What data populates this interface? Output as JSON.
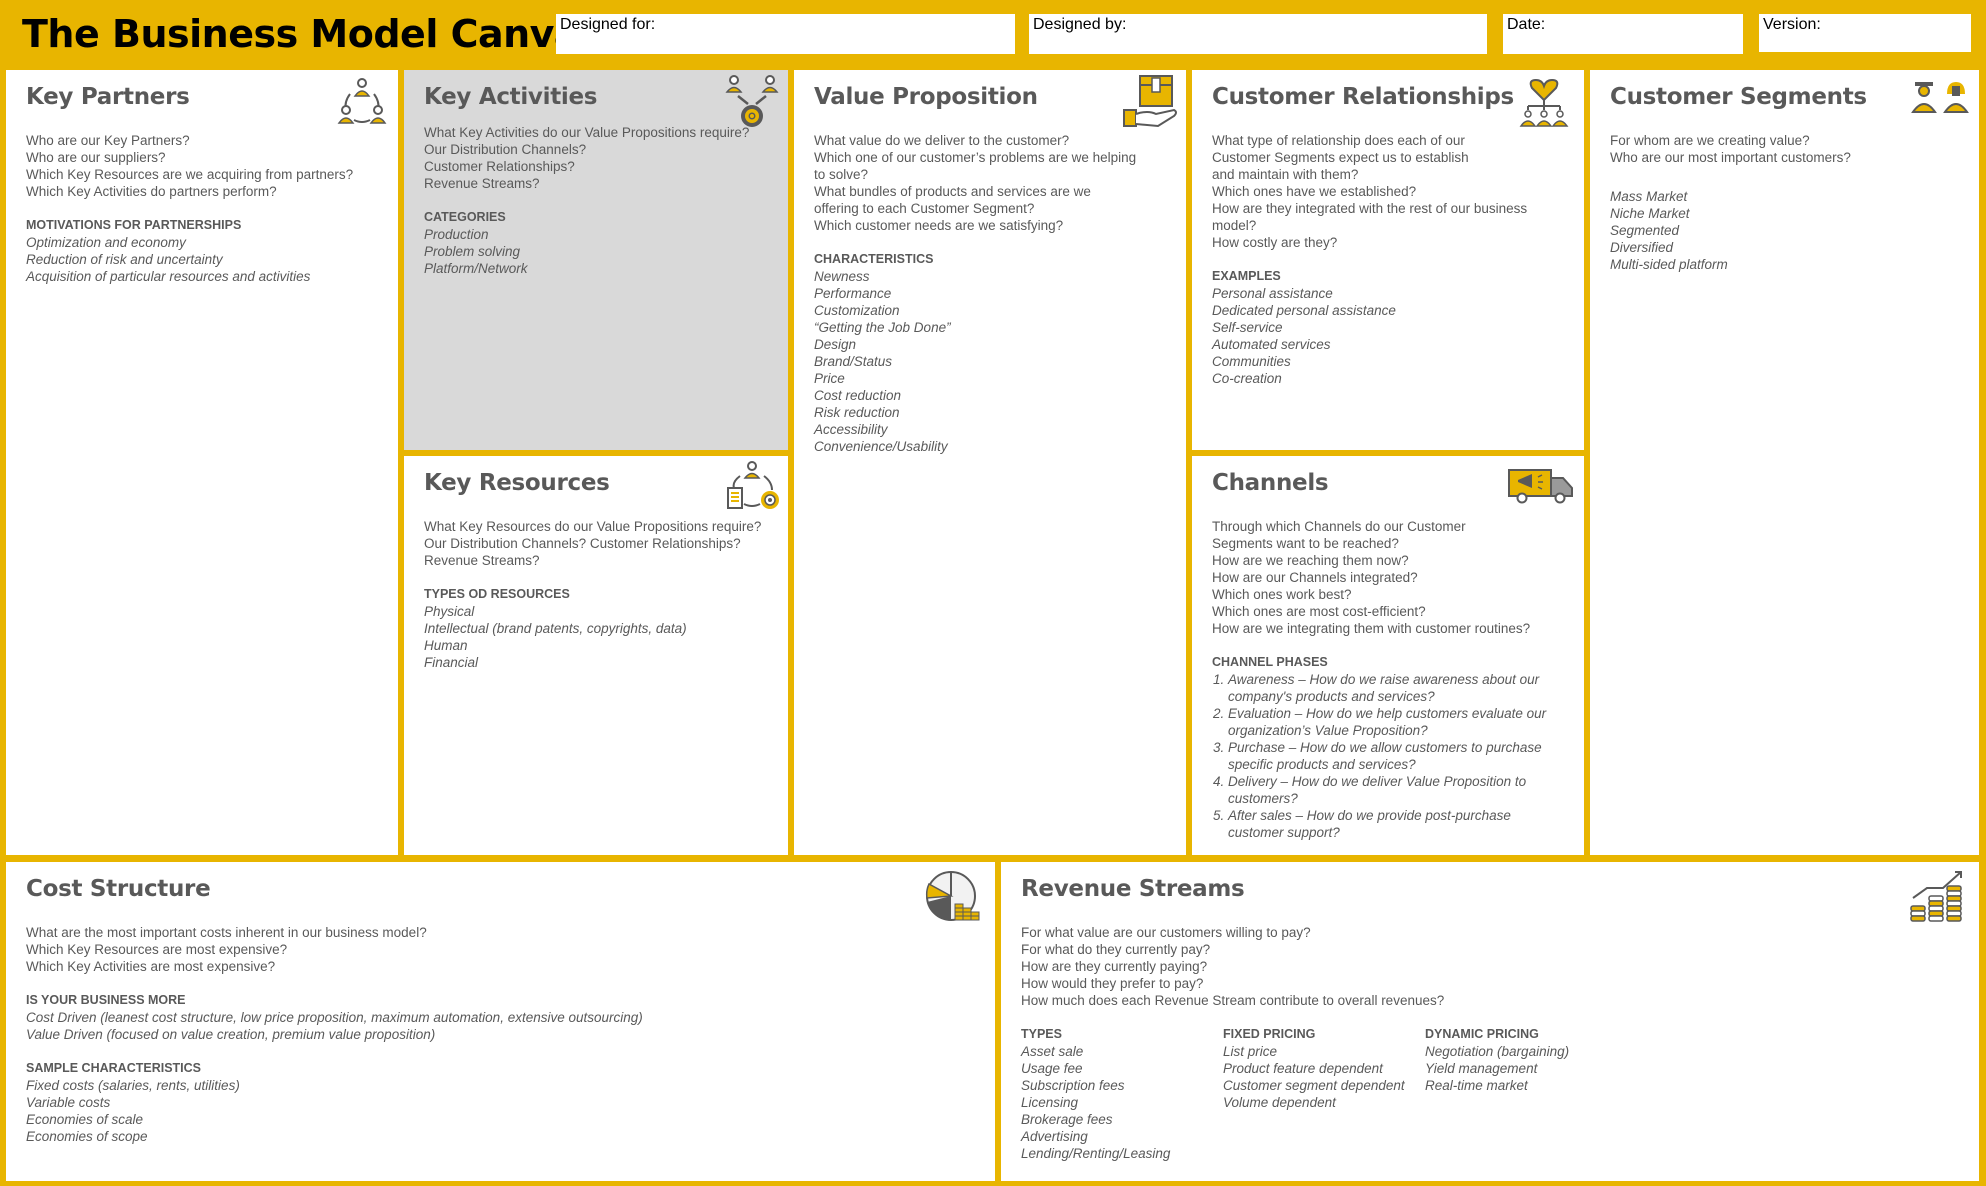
{
  "header": {
    "title": "The Business Model Canvas",
    "fields": [
      {
        "label": "Designed for:",
        "value": ""
      },
      {
        "label": "Designed by:",
        "value": ""
      },
      {
        "label": "Date:",
        "value": ""
      },
      {
        "label": "Version:",
        "value": ""
      }
    ]
  },
  "colors": {
    "accent": "#E8B500",
    "text": "#595959",
    "highlight_box": "#D9D9D9"
  },
  "key_partners": {
    "title": "Key Partners",
    "icon": "partners-network-icon",
    "questions": [
      "Who are our Key Partners?",
      "Who are our suppliers?",
      "Which Key Resources are we acquiring from partners?",
      "Which Key Activities do partners perform?"
    ],
    "section_title": "MOTIVATIONS FOR PARTNERSHIPS",
    "items": [
      "Optimization and economy",
      "Reduction of risk and uncertainty",
      "Acquisition of particular resources and activities"
    ]
  },
  "key_activities": {
    "title": "Key Activities",
    "icon": "people-gear-icon",
    "questions": [
      "What Key Activities do our Value Propositions require?",
      "Our Distribution Channels?",
      "Customer Relationships?",
      "Revenue Streams?"
    ],
    "section_title": "CATEGORIES",
    "items": [
      "Production",
      "Problem solving",
      "Platform/Network"
    ]
  },
  "key_resources": {
    "title": "Key Resources",
    "icon": "resources-cycle-icon",
    "questions": [
      "What Key Resources do our Value Propositions require?",
      "Our Distribution Channels? Customer Relationships? Revenue Streams?"
    ],
    "section_title": "TYPES OD RESOURCES",
    "items": [
      "Physical",
      "Intellectual (brand patents, copyrights, data)",
      "Human",
      "Financial"
    ]
  },
  "value_proposition": {
    "title": "Value Proposition",
    "icon": "box-in-hand-icon",
    "questions": [
      "What value do we deliver to the customer?",
      "Which one of our customer’s problems are we helping to solve?",
      "What bundles of products and services are we offering to each Customer Segment?",
      "Which customer needs are we satisfying?"
    ],
    "section_title": "CHARACTERISTICS",
    "items": [
      "Newness",
      "Performance",
      "Customization",
      "“Getting the Job Done”",
      "Design",
      "Brand/Status",
      "Price",
      "Cost reduction",
      "Risk reduction",
      "Accessibility",
      "Convenience/Usability"
    ]
  },
  "customer_relationships": {
    "title": "Customer Relationships",
    "icon": "handshake-heart-icon",
    "questions": [
      "What type of relationship does each of our Customer Segments expect us to establish and maintain with them?",
      "Which ones have we established?",
      "How are they integrated with the rest of our business model?",
      "How costly are they?"
    ],
    "section_title": "EXAMPLES",
    "items": [
      "Personal assistance",
      "Dedicated personal assistance",
      "Self-service",
      "Automated services",
      "Communities",
      "Co-creation"
    ]
  },
  "channels": {
    "title": "Channels",
    "icon": "delivery-truck-icon",
    "questions": [
      "Through which Channels do our Customer Segments want to be reached?",
      "How are we reaching them now?",
      "How are our Channels integrated?",
      "Which ones work best?",
      "Which ones are most cost-efficient?",
      "How are we integrating them with customer routines?"
    ],
    "section_title": "CHANNEL PHASES",
    "phases": [
      "Awareness – How do we raise awareness about our company's products and services?",
      "Evaluation – How do we help customers evaluate our organization’s Value Proposition?",
      "Purchase – How do we allow customers to purchase specific products and services?",
      "Delivery – How do we deliver Value Proposition to customers?",
      "After sales – How do we provide post-purchase customer support?"
    ]
  },
  "customer_segments": {
    "title": "Customer Segments",
    "icon": "customers-icon",
    "questions": [
      "For whom are we creating value?",
      "Who are our most important customers?"
    ],
    "items": [
      "Mass Market",
      "Niche Market",
      "Segmented",
      "Diversified",
      "Multi-sided platform"
    ]
  },
  "cost_structure": {
    "title": "Cost Structure",
    "icon": "pie-chart-coins-icon",
    "questions": [
      "What are the most important costs inherent in our business model?",
      "Which Key Resources are most expensive?",
      "Which Key Activities are most expensive?"
    ],
    "section1_title": "IS YOUR BUSINESS MORE",
    "section1_items": [
      "Cost Driven (leanest cost structure, low price proposition, maximum automation, extensive outsourcing)",
      "Value Driven (focused on value creation, premium value proposition)"
    ],
    "section2_title": "SAMPLE CHARACTERISTICS",
    "section2_items": [
      "Fixed costs (salaries, rents, utilities)",
      "Variable costs",
      "Economies of scale",
      "Economies of scope"
    ]
  },
  "revenue_streams": {
    "title": "Revenue Streams",
    "icon": "coins-growth-icon",
    "questions": [
      "For what value are our customers willing to pay?",
      "For what do they currently pay?",
      "How are they currently paying?",
      "How would they prefer to pay?",
      "How much does each Revenue Stream contribute to overall revenues?"
    ],
    "columns": [
      {
        "title": "TYPES",
        "items": [
          "Asset sale",
          "Usage fee",
          "Subscription fees",
          "Licensing",
          "Brokerage fees",
          "Advertising",
          "Lending/Renting/Leasing"
        ]
      },
      {
        "title": "FIXED PRICING",
        "items": [
          "List price",
          "Product feature dependent",
          "Customer segment dependent",
          "Volume dependent"
        ]
      },
      {
        "title": "DYNAMIC PRICING",
        "items": [
          "Negotiation (bargaining)",
          "Yield management",
          "Real-time market"
        ]
      }
    ]
  }
}
